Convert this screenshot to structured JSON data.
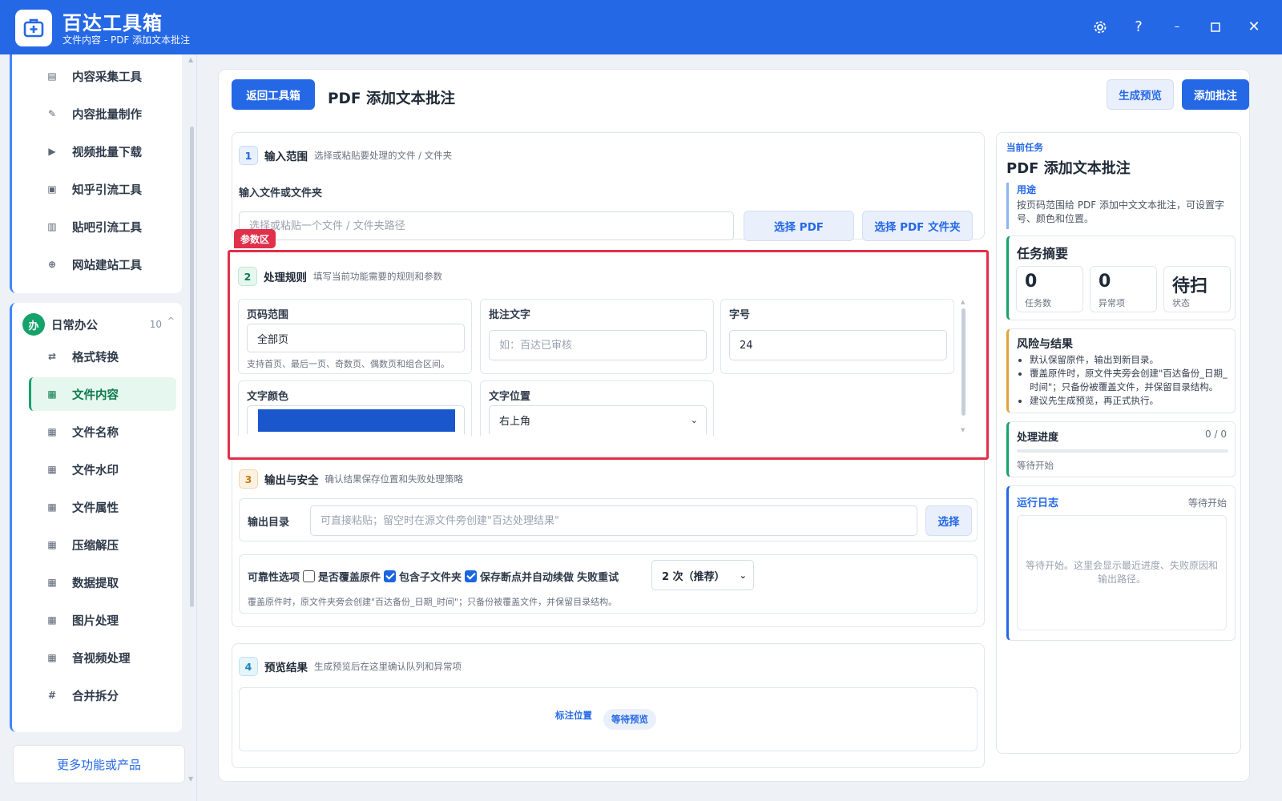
{
  "app": {
    "title": "百达工具箱",
    "subtitle": "文件内容 - PDF 添加文本批注",
    "window_controls": [
      "gear-icon",
      "help-icon",
      "minimize-icon",
      "maximize-icon",
      "close-icon"
    ]
  },
  "sidebar": {
    "group1_items": [
      {
        "label": "内容采集工具",
        "icon": "clipboard-icon"
      },
      {
        "label": "内容批量制作",
        "icon": "pen-icon"
      },
      {
        "label": "视频批量下载",
        "icon": "video-icon"
      },
      {
        "label": "知乎引流工具",
        "icon": "zhihu-icon"
      },
      {
        "label": "贴吧引流工具",
        "icon": "tieba-icon"
      },
      {
        "label": "网站建站工具",
        "icon": "web-icon"
      }
    ],
    "group2": {
      "badge": "办",
      "name": "日常办公",
      "count": "10",
      "caret": "^",
      "items": [
        {
          "label": "格式转换",
          "icon": "swap-icon"
        },
        {
          "label": "文件内容",
          "icon": "grid-icon",
          "active": true
        },
        {
          "label": "文件名称",
          "icon": "grid-icon"
        },
        {
          "label": "文件水印",
          "icon": "grid-icon"
        },
        {
          "label": "文件属性",
          "icon": "grid-icon"
        },
        {
          "label": "压缩解压",
          "icon": "grid-icon"
        },
        {
          "label": "数据提取",
          "icon": "grid-icon"
        },
        {
          "label": "图片处理",
          "icon": "grid-icon"
        },
        {
          "label": "音视频处理",
          "icon": "grid-icon"
        },
        {
          "label": "合并拆分",
          "icon": "hash-icon"
        }
      ]
    },
    "more_label": "更多功能或产品"
  },
  "main": {
    "back_label": "返回工具箱",
    "title": "PDF 添加文本批注",
    "preview_label": "生成预览",
    "add_label": "添加批注"
  },
  "sec1": {
    "num": "1",
    "title": "输入范围",
    "desc": "选择或粘贴要处理的文件 / 文件夹",
    "field_label": "输入文件或文件夹",
    "placeholder": "选择或粘贴一个文件 / 文件夹路径",
    "pick_pdf": "选择 PDF",
    "pick_folder": "选择 PDF 文件夹"
  },
  "param_tag": "参数区",
  "sec2": {
    "num": "2",
    "title": "处理规则",
    "desc": "填写当前功能需要的规则和参数",
    "page_range": {
      "label": "页码范围",
      "value": "全部页",
      "hint": "支持首页、最后一页、奇数页、偶数页和组合区间。"
    },
    "annotation": {
      "label": "批注文字",
      "placeholder": "如：百达已审核"
    },
    "font_size": {
      "label": "字号",
      "value": "24"
    },
    "color": {
      "label": "文字颜色",
      "value": "#1a56cc"
    },
    "position": {
      "label": "文字位置",
      "value": "右上角"
    }
  },
  "sec3": {
    "num": "3",
    "title": "输出与安全",
    "desc": "确认结果保存位置和失败处理策略",
    "out_label": "输出目录",
    "out_placeholder": "可直接粘贴；留空时在源文件旁创建\"百达处理结果\"",
    "out_pick": "选择",
    "rel_label": "可靠性选项",
    "overwrite": {
      "label": "是否覆盖原件",
      "checked": false
    },
    "subfolders": {
      "label": "包含子文件夹",
      "checked": true
    },
    "resume": {
      "label": "保存断点并自动续做",
      "checked": true
    },
    "retry_label": "失败重试",
    "retry_value": "2 次（推荐）",
    "note": "覆盖原件时，原文件夹旁会创建\"百达备份_日期_时间\"；只备份被覆盖文件，并保留目录结构。"
  },
  "sec4": {
    "num": "4",
    "title": "预览结果",
    "desc": "生成预览后在这里确认队列和异常项",
    "mark_label": "标注位置",
    "status_label": "等待预览"
  },
  "right": {
    "current_label": "当前任务",
    "current_title": "PDF 添加文本批注",
    "purpose_label": "用途",
    "purpose_text": "按页码范围给 PDF 添加中文文本批注，可设置字号、颜色和位置。",
    "summary_title": "任务摘要",
    "stats": [
      {
        "value": "0",
        "label": "任务数"
      },
      {
        "value": "0",
        "label": "异常项"
      },
      {
        "value": "待扫",
        "label": "状态"
      }
    ],
    "risk_title": "风险与结果",
    "risk_items": [
      "默认保留原件，输出到新目录。",
      "覆盖原件时，原文件夹旁会创建\"百达备份_日期_时间\"；只备份被覆盖文件，并保留目录结构。",
      "建议先生成预览，再正式执行。"
    ],
    "progress_title": "处理进度",
    "progress_count": "0 / 0",
    "progress_value": 0,
    "progress_status": "等待开始",
    "log_title": "运行日志",
    "log_status": "等待开始",
    "log_text": "等待开始。这里会显示最近进度、失败原因和输出路径。"
  },
  "colors": {
    "accent": "#2568e6",
    "active": "#16a36b",
    "danger": "#e0304a"
  }
}
